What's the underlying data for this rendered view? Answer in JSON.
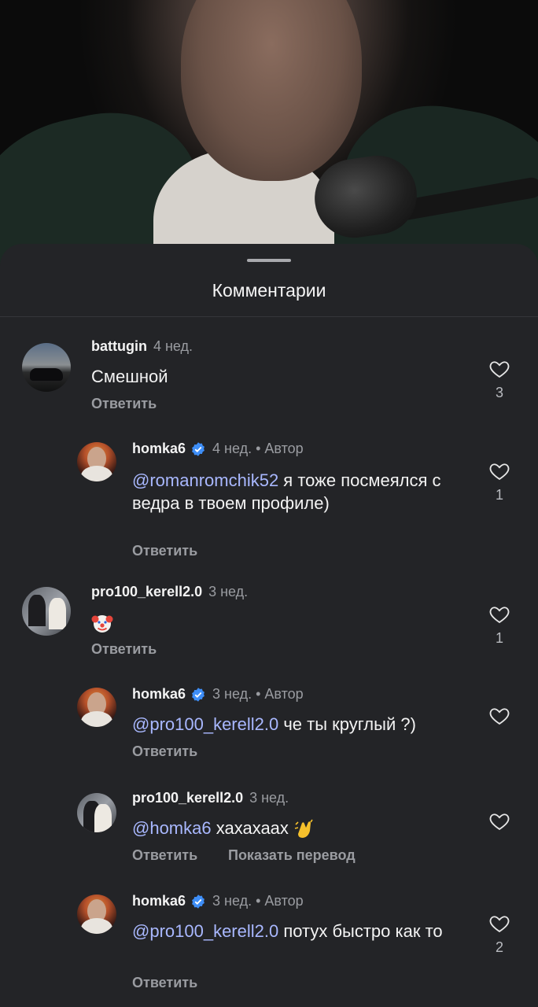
{
  "sheet": {
    "title": "Комментарии"
  },
  "comments": [
    {
      "username": "battugin",
      "time": "4 нед.",
      "text": "Смешной",
      "reply": "Ответить",
      "likes": "3",
      "avatar": "car-avatar"
    },
    {
      "username": "homka6",
      "time": "4 нед. • Автор",
      "mention": "@romanromchik52",
      "text": " я тоже посмеялся с ведра в твоем профиле)",
      "reply": "Ответить",
      "likes": "1",
      "avatar": "author-avatar",
      "verified": true
    },
    {
      "username": "pro100_kerell2.0",
      "time": "3 нед.",
      "text": "",
      "emoji": "clown-face-emoji",
      "reply": "Ответить",
      "likes": "1",
      "avatar": "couple-avatar"
    },
    {
      "username": "homka6",
      "time": "3 нед. • Автор",
      "mention": "@pro100_kerell2.0",
      "text": " че ты круглый ?)",
      "reply": "Ответить",
      "likes": "",
      "avatar": "author-avatar",
      "verified": true
    },
    {
      "username": "pro100_kerell2.0",
      "time": "3 нед.",
      "mention": "@homka6",
      "text": " хахахаах",
      "emoji": "clapping-hands-emoji",
      "reply": "Ответить",
      "translate": "Показать перевод",
      "likes": "",
      "avatar": "couple-avatar"
    },
    {
      "username": "homka6",
      "time": "3 нед. • Автор",
      "mention": "@pro100_kerell2.0",
      "text": " потух быстро как то",
      "reply": "Ответить",
      "likes": "2",
      "avatar": "author-avatar",
      "verified": true
    }
  ],
  "icons": {
    "like": "heart-outline-icon",
    "verified": "verified-badge-icon"
  },
  "colors": {
    "sheet_bg": "#232427",
    "mention": "#a9b8ff",
    "verified": "#3e8ef7",
    "muted": "#9a9ca1"
  }
}
